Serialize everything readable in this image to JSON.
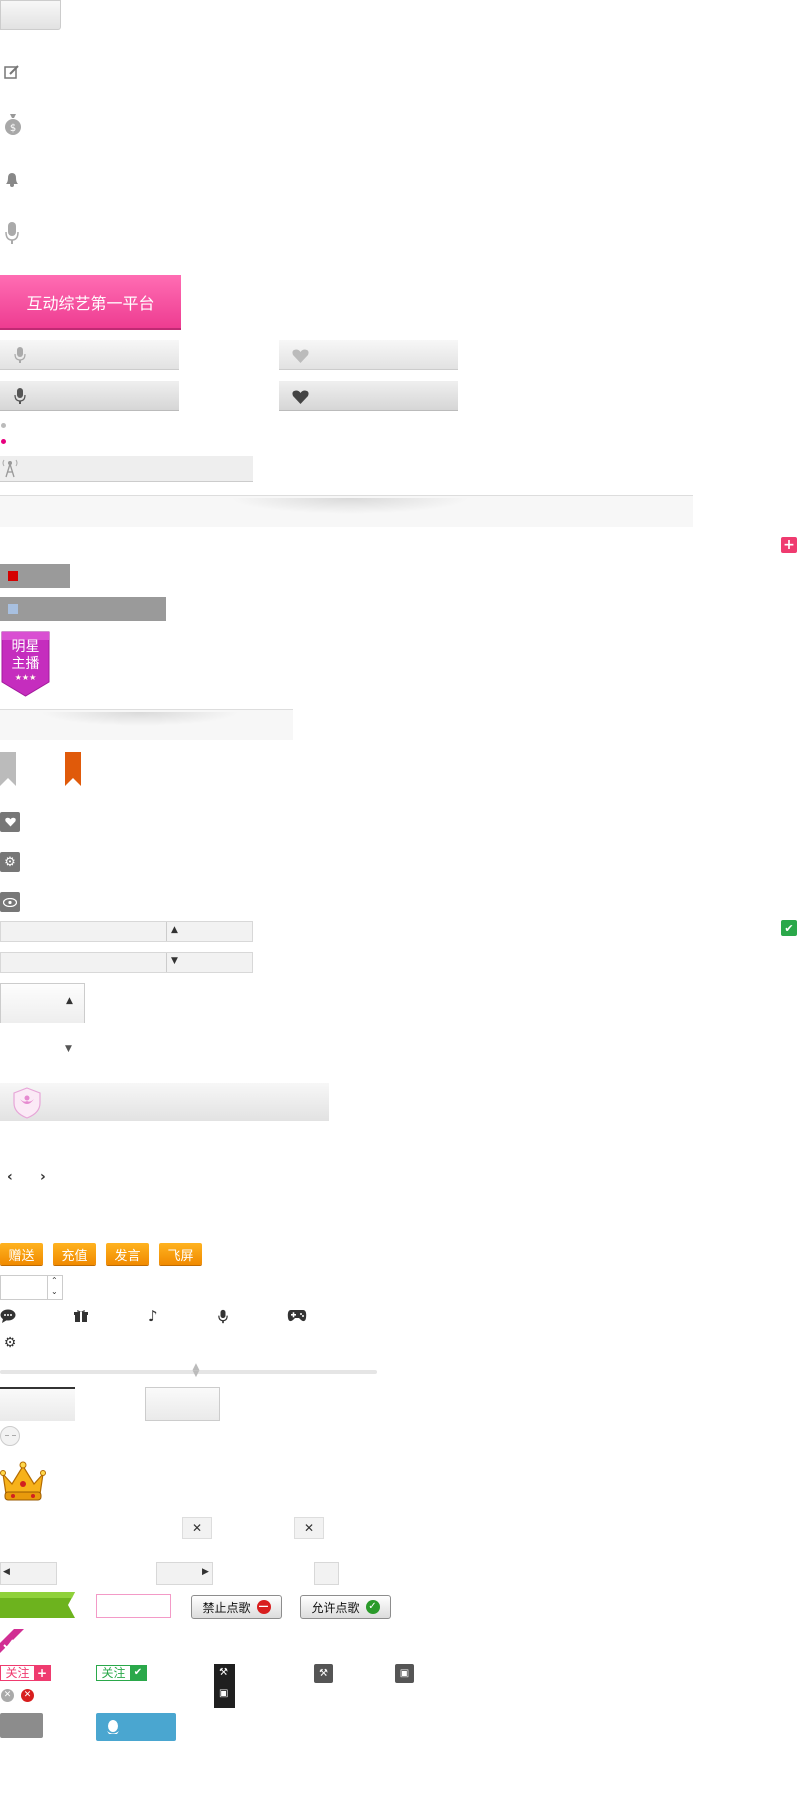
{
  "banner": {
    "title": "互动综艺第一平台"
  },
  "badge": {
    "line1": "明星",
    "line2": "主播",
    "stars": "★★★"
  },
  "actions": {
    "gift": "赠送",
    "recharge": "充值",
    "speak": "发言",
    "flyscreen": "飞屏"
  },
  "song_controls": {
    "forbid": "禁止点歌",
    "allow": "允许点歌"
  },
  "follow": {
    "label_add": "关注",
    "label_done": "关注"
  },
  "close_glyph": "✕",
  "colors": {
    "pink": "#ef3b8f",
    "orange": "#f59a00",
    "green": "#3aa63a",
    "blue": "#4aa6d0"
  }
}
